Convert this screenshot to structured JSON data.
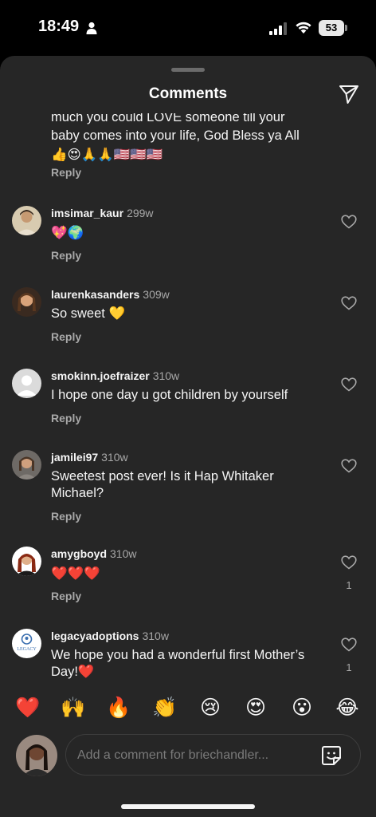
{
  "status_bar": {
    "time": "18:49",
    "battery": "53"
  },
  "header": {
    "title": "Comments"
  },
  "partial_comment": {
    "text_line1": "much you could LOVE someone till your",
    "text_line2": "baby comes into your life, God Bless ya All",
    "emoji_line": "👍😍🙏🙏🇺🇸🇺🇸🇺🇸",
    "reply_label": "Reply"
  },
  "comments": [
    {
      "username": "imsimar_kaur",
      "time": "299w",
      "text": "💖🌍",
      "reply_label": "Reply",
      "likes": ""
    },
    {
      "username": "laurenkasanders",
      "time": "309w",
      "text": "So sweet 💛",
      "reply_label": "Reply",
      "likes": ""
    },
    {
      "username": "smokinn.joefraizer",
      "time": "310w",
      "text": "I hope one day u got children by yourself",
      "reply_label": "Reply",
      "likes": ""
    },
    {
      "username": "jamilei97",
      "time": "310w",
      "text": "Sweetest post ever! Is it Hap Whitaker Michael?",
      "reply_label": "Reply",
      "likes": ""
    },
    {
      "username": "amygboyd",
      "time": "310w",
      "text": "❤️❤️❤️",
      "reply_label": "Reply",
      "likes": "1"
    },
    {
      "username": "legacyadoptions",
      "time": "310w",
      "text": "We hope you had a wonderful first Mother’s Day!❤️",
      "reply_label": "",
      "likes": "1"
    }
  ],
  "legacy_logo_text": "LEGACY",
  "emoji_bar": [
    "❤️",
    "🙌",
    "🔥",
    "👏",
    "😢",
    "😍",
    "😮",
    "😂"
  ],
  "composer": {
    "placeholder": "Add a comment for briechandler..."
  },
  "colors": {
    "sheet_bg": "#262626",
    "secondary_text": "#a8a8a8",
    "primary_text": "#f5f5f5"
  }
}
